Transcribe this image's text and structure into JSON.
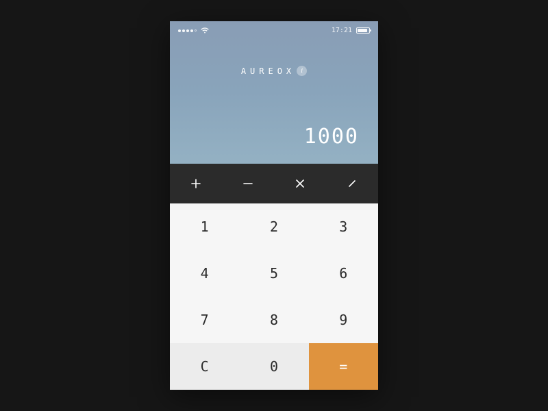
{
  "statusbar": {
    "time": "17:21"
  },
  "app": {
    "name": "AUREOX"
  },
  "display": {
    "value": "1000"
  },
  "ops": {
    "add": "+",
    "sub": "−",
    "mul": "×",
    "div": "∕"
  },
  "keys": {
    "k1": "1",
    "k2": "2",
    "k3": "3",
    "k4": "4",
    "k5": "5",
    "k6": "6",
    "k7": "7",
    "k8": "8",
    "k9": "9",
    "clear": "C",
    "k0": "0",
    "eq": "="
  }
}
